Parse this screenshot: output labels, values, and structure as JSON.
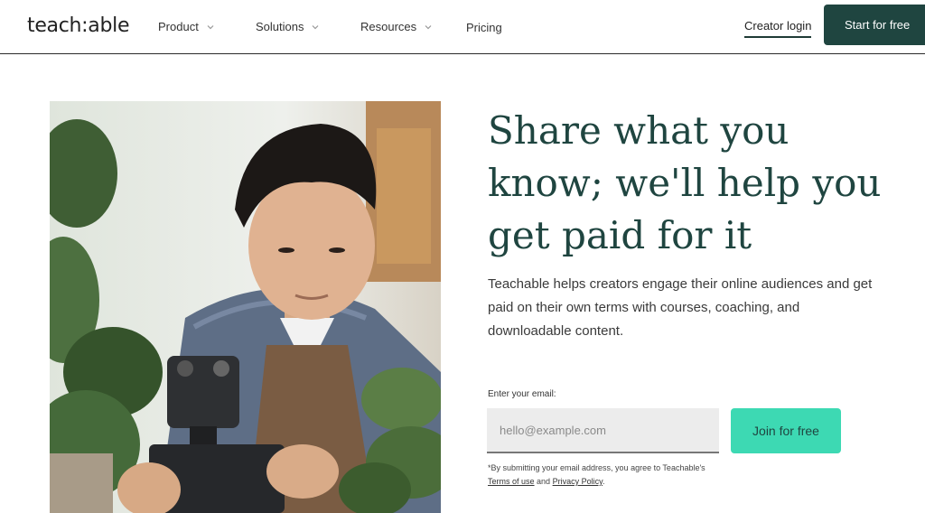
{
  "header": {
    "logo": "teach:able",
    "nav": [
      {
        "label": "Product"
      },
      {
        "label": "Solutions"
      },
      {
        "label": "Resources"
      },
      {
        "label": "Pricing"
      }
    ],
    "creator_login": "Creator login",
    "start_label": "Start for free"
  },
  "hero": {
    "headline": "Share what you know; we'll help you get paid for it",
    "subtext": "Teachable helps creators engage their online audiences and get paid on their own terms with courses, coaching, and downloadable content.",
    "email_label": "Enter your email:",
    "email_placeholder": "hello@example.com",
    "email_value": "",
    "join_label": "Join for free",
    "disclaimer_prefix": "*By submitting your email address, you agree to Teachable's",
    "terms_label": "Terms of use",
    "and_text": "and",
    "privacy_label": "Privacy Policy",
    "disclaimer_suffix": "."
  },
  "colors": {
    "brand_dark": "#1f4540",
    "accent_mint": "#3dd9b3"
  }
}
